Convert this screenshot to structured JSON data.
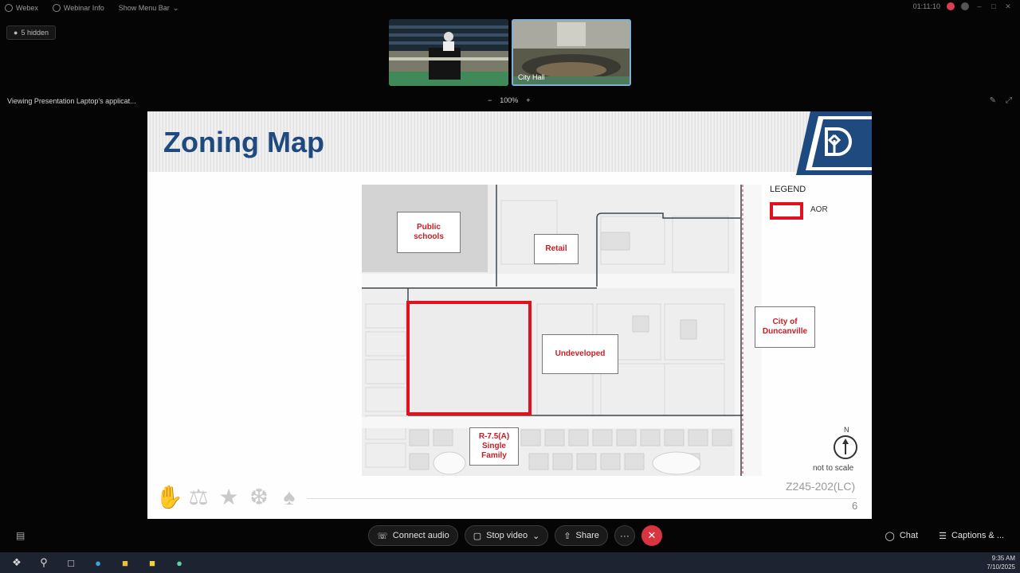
{
  "titlebar": {
    "app_name": "Webex",
    "webinar_info": "Webinar Info",
    "menu_bar": "Show Menu Bar",
    "timer": "01:11:10"
  },
  "hidden_chip": "5 hidden",
  "thumbnails": [
    {
      "label": ""
    },
    {
      "label": "City Hall"
    }
  ],
  "viewing_text": "Viewing Presentation Laptop's applicat...",
  "zoom": {
    "minus": "−",
    "value": "100%",
    "plus": "+"
  },
  "slide": {
    "title": "Zoning Map",
    "map_labels": {
      "public_schools": "Public\nschools",
      "retail": "Retail",
      "undeveloped": "Undeveloped",
      "r75a": "R-7.5(A)\nSingle\nFamily",
      "duncanville": "City of\nDuncanville"
    },
    "legend": {
      "title": "LEGEND",
      "aor": "AOR"
    },
    "north": {
      "letter": "N",
      "scale": "not to scale"
    },
    "case_id": "Z245-202(LC)",
    "page": "6"
  },
  "controls": {
    "audio": "Connect audio",
    "video": "Stop video",
    "share": "Share",
    "more": "···",
    "end": "✕",
    "chat": "Chat",
    "captions": "Captions & ..."
  },
  "taskbar": {
    "time": "9:35 AM",
    "date": "7/10/2025"
  },
  "colors": {
    "title_blue": "#1f4a7f",
    "aor_red": "#e0121f",
    "label_red": "#c81d25",
    "end_button": "#d9343f"
  }
}
